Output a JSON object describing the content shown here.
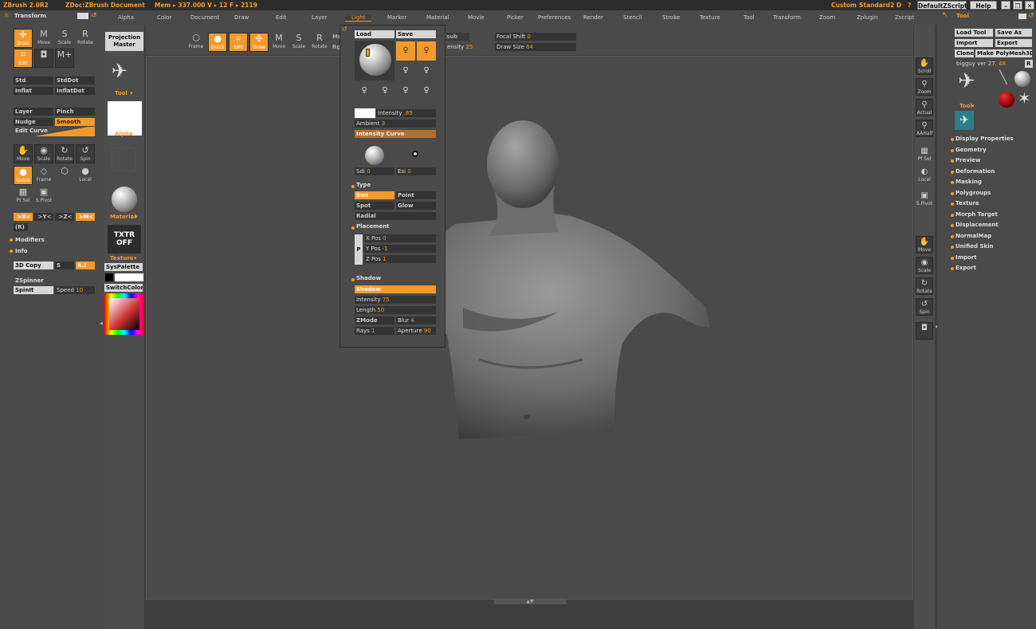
{
  "titlebar": {
    "app": "ZBrush 2.0R2",
    "doc": "ZDoc:ZBrush Document",
    "stats": "Mem ▸ 337.000  V ▸ 12  F ▸ 2119",
    "custom": "Custom",
    "standard": "Standard",
    "twod": "2 D",
    "help_q": "?",
    "defaultzscript": "DefaultZScript",
    "help": "Help"
  },
  "menubar": [
    "Alpha",
    "Color",
    "Document",
    "Draw",
    "Edit",
    "Layer",
    "Light",
    "Marker",
    "Material",
    "Movie",
    "Picker",
    "Preferences",
    "Render",
    "Stencil",
    "Stroke",
    "Texture",
    "Tool",
    "Transform",
    "Zoom",
    "Zplugin",
    "Zscript"
  ],
  "left": {
    "title": "Transform",
    "top_icons": [
      {
        "g": "✣",
        "l": "Draw"
      },
      {
        "g": "M",
        "l": "Move"
      },
      {
        "g": "S",
        "l": "Scale"
      },
      {
        "g": "R",
        "l": "Rotate"
      },
      {
        "g": "⌗",
        "l": "Edit"
      },
      {
        "g": "◘",
        "l": ""
      },
      {
        "g": "M+",
        "l": ""
      }
    ],
    "brushes": [
      "Std",
      "StdDot",
      "Inflat",
      "InflatDot",
      "Layer",
      "Pinch",
      "Nudge",
      "Smooth"
    ],
    "edit_curve": "Edit Curve",
    "tools": [
      {
        "g": "✋",
        "l": "Move"
      },
      {
        "g": "◉",
        "l": "Scale"
      },
      {
        "g": "↻",
        "l": "Rotate"
      },
      {
        "g": "↺",
        "l": "Spin"
      },
      {
        "g": "●",
        "l": "Quick"
      },
      {
        "g": "◇",
        "l": "Frame"
      },
      {
        "g": "⬡",
        "l": ""
      },
      {
        "g": "●",
        "l": "Local"
      },
      {
        "g": "▦",
        "l": "Pt Sel"
      },
      {
        "g": "▣",
        "l": "S.Pivot"
      }
    ],
    "axis": [
      ">X<",
      ">Y<",
      ">Z<",
      ">M<"
    ],
    "r": "(R)",
    "modifiers": "Modifiers",
    "info": "Info",
    "copy3d": "3D Copy",
    "s": "S",
    "ai": "A.I",
    "zspinner": "ZSpinner",
    "spinit": "SpinIt",
    "speed": "Speed",
    "speed_val": "10"
  },
  "strip": {
    "tool": "Tool",
    "alpha": "Alpha",
    "material": "Material",
    "txtr": "TXTR OFF",
    "texture": "Texture",
    "projection": "Projection Master",
    "syspalette": "SysPalette",
    "switchcolor": "SwitchColor"
  },
  "shelf": {
    "frame": "Frame",
    "quick": "Quick",
    "edit": "Edit",
    "draw": "Draw",
    "move": "Move",
    "scale": "Scale",
    "rotate": "Rotate",
    "mrgb": "Mrgb",
    "rgb": "Rgb In",
    "zsub": "Zsub",
    "zsub_int_label": "ensity",
    "zsub_int": "25",
    "focal": "Focal Shift",
    "focal_val": "0",
    "drawsize": "Draw Size",
    "drawsize_val": "64"
  },
  "light": {
    "load": "Load",
    "save": "Save",
    "intensity": "Intensity",
    "intensity_val": ".85",
    "ambient": "Ambient",
    "ambient_val": "3",
    "intensity_curve": "Intensity Curve",
    "sdi": "Sdi",
    "sdi_val": "0",
    "esi": "Esi",
    "esi_val": "0",
    "type": "Type",
    "sun": "Sun",
    "point": "Point",
    "spot": "Spot",
    "glow": "Glow",
    "radial": "Radial",
    "placement": "Placement",
    "p": "P",
    "xpos": "X Pos",
    "xpos_val": "0",
    "ypos": "Y Pos",
    "ypos_val": "-1",
    "zpos": "Z Pos",
    "zpos_val": "1",
    "shadow_h": "Shadow",
    "shadow": "Shadow",
    "s_intensity": "Intensity",
    "s_intensity_val": "75",
    "length": "Length",
    "length_val": "50",
    "zmode": "ZMode",
    "blur": "Blur",
    "blur_val": "4",
    "rays": "Rays",
    "rays_val": "1",
    "aperture": "Aperture",
    "aperture_val": "90"
  },
  "right": {
    "title": "Tool",
    "load_tool": "Load Tool",
    "save_as": "Save As",
    "import": "Import",
    "export": "Export",
    "clone": "Clone",
    "make": "Make PolyMesh3D",
    "bigguy": "bigguy ver 27.",
    "bigguy_val": "48",
    "r": "R",
    "tool": "Tool",
    "menu": [
      "Display Properties",
      "Geometry",
      "Preview",
      "Deformation",
      "Masking",
      "Polygroups",
      "Texture",
      "Morph Target",
      "Displacement",
      "NormalMap",
      "Unified Skin",
      "Import",
      "Export"
    ]
  },
  "rstrip": [
    {
      "g": "✋",
      "l": "Scroll"
    },
    {
      "g": "⚲",
      "l": "Zoom"
    },
    {
      "g": "⚲",
      "l": "Actual"
    },
    {
      "g": "⚲",
      "l": "AAHalf"
    },
    {
      "g": "▦",
      "l": "Pf Sel"
    },
    {
      "g": "◐",
      "l": "Local"
    },
    {
      "g": "▣",
      "l": "S.Pivot"
    },
    {
      "g": "✋",
      "l": "Move"
    },
    {
      "g": "◉",
      "l": "Scale"
    },
    {
      "g": "↻",
      "l": "Rotate"
    },
    {
      "g": "↺",
      "l": "Spin"
    },
    {
      "g": "◘",
      "l": ""
    }
  ],
  "colors": {
    "accent": "#f39a2b",
    "panel": "#4a4a4a",
    "canvas": "#4a4a4a"
  }
}
